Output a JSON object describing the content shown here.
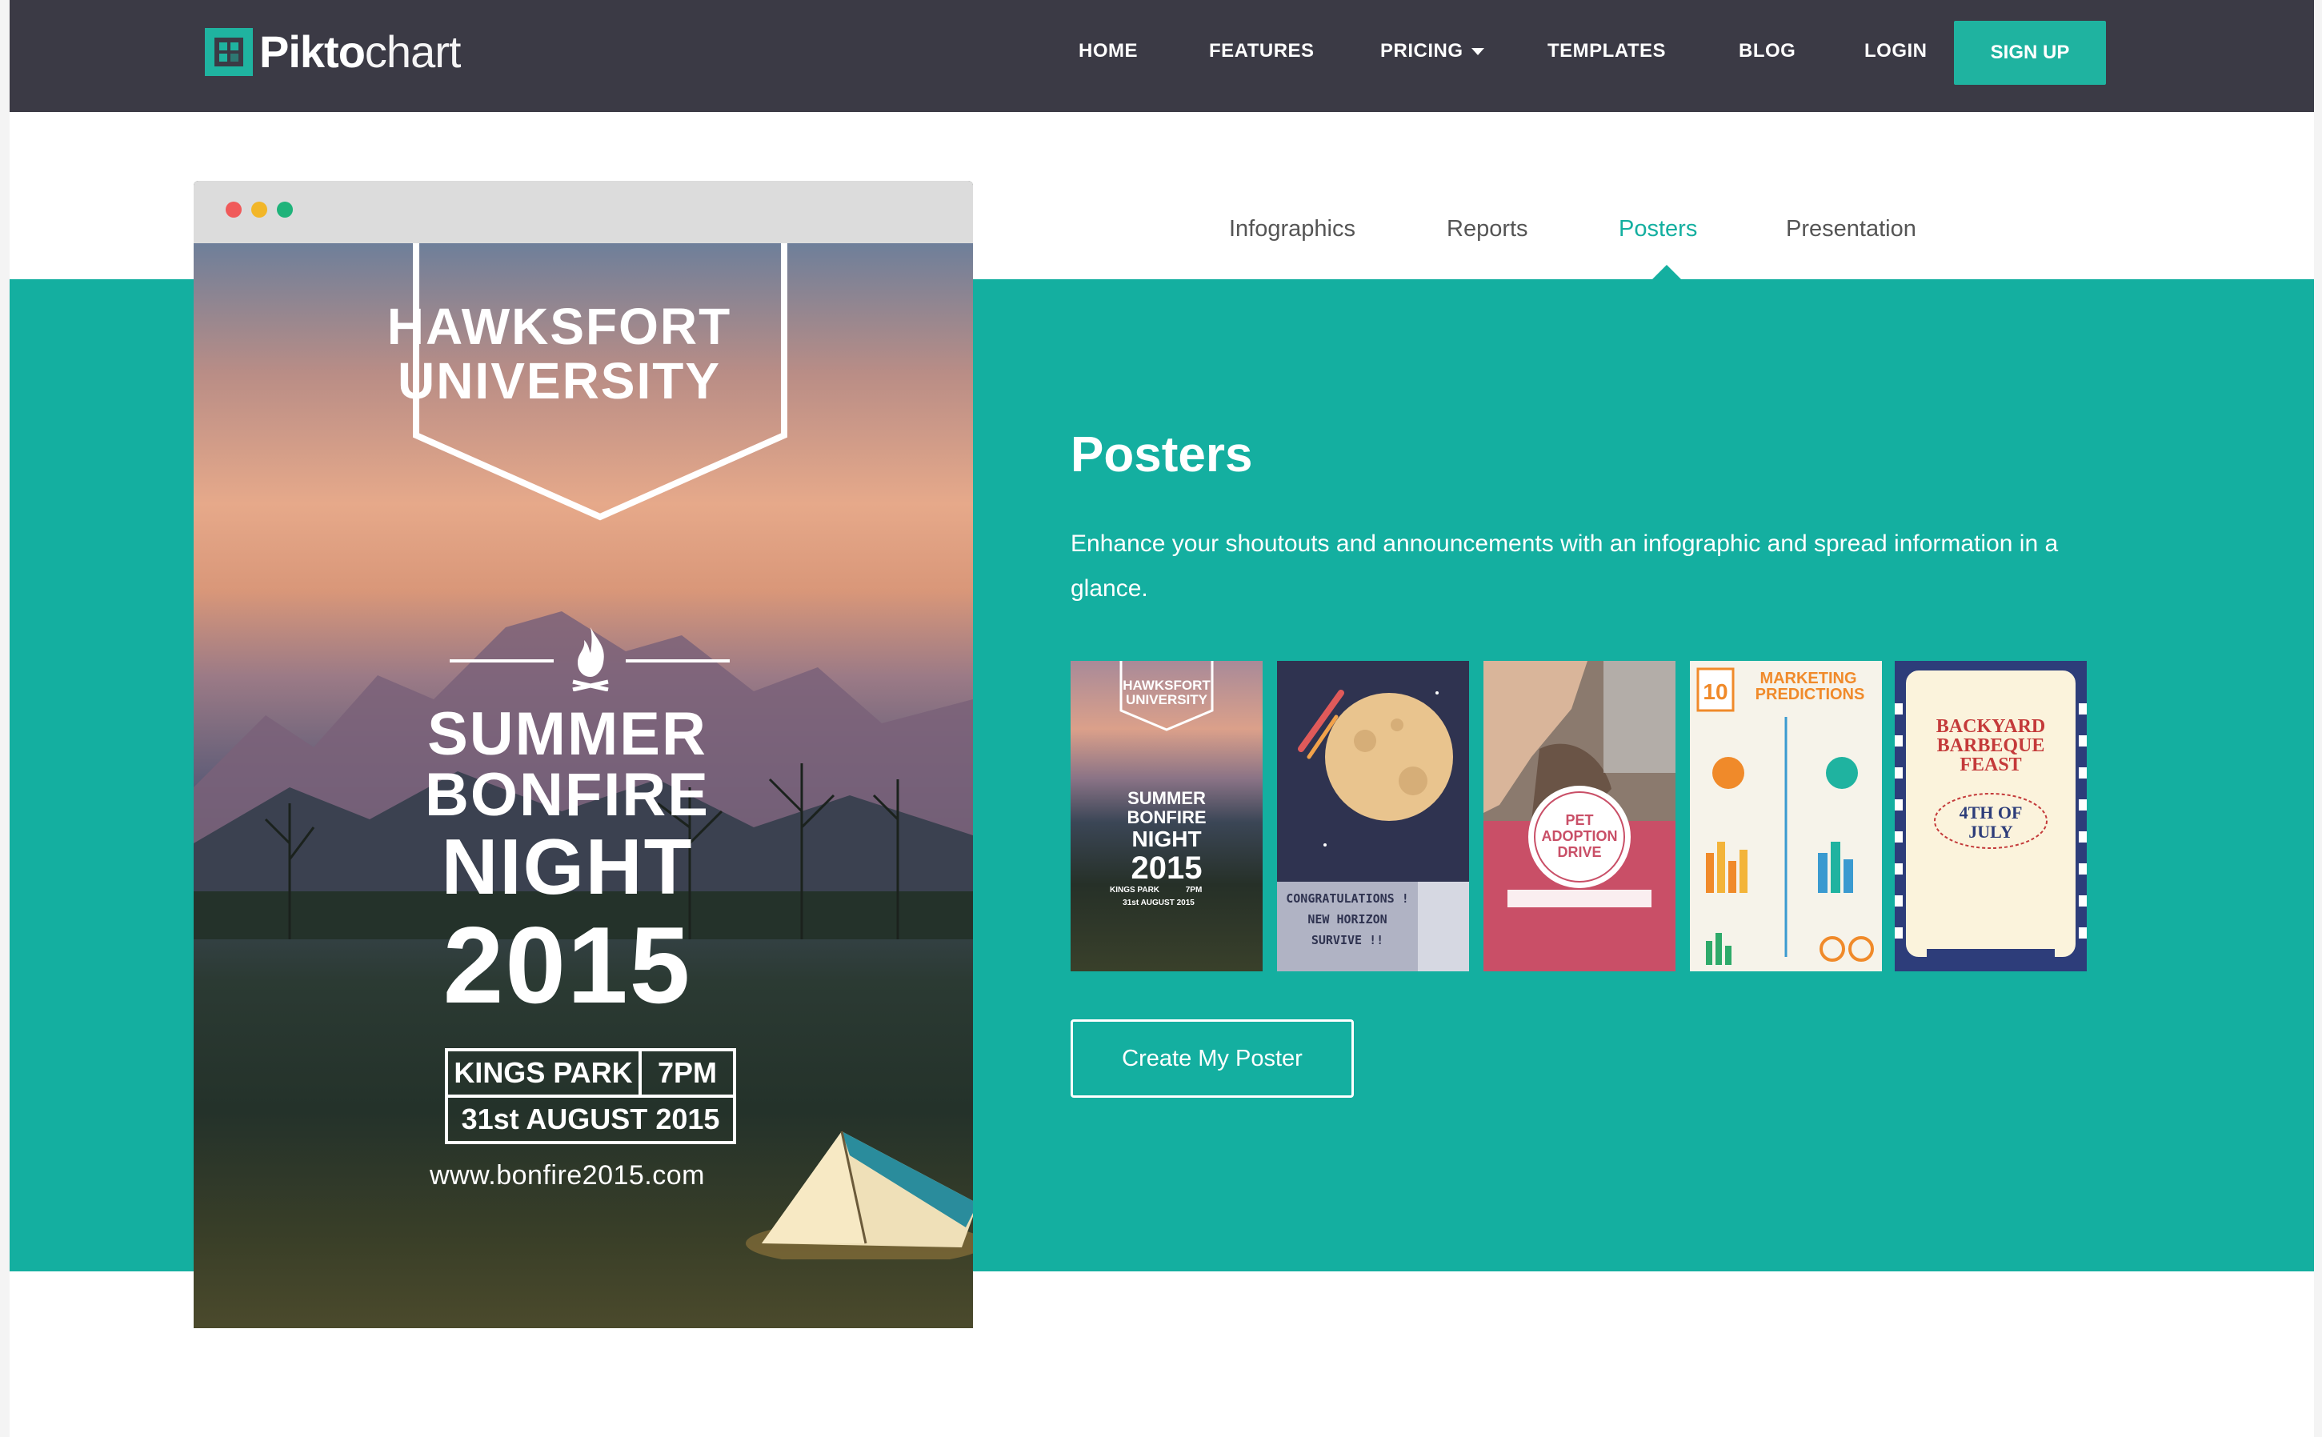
{
  "brand": {
    "logo_bold": "Pikto",
    "logo_light": "chart",
    "accent": "#14afa0",
    "nav_bg": "#3b3a45"
  },
  "nav": {
    "items": [
      "HOME",
      "FEATURES",
      "PRICING",
      "TEMPLATES",
      "BLOG",
      "LOGIN"
    ],
    "signup": "SIGN UP"
  },
  "tabs": {
    "items": [
      "Infographics",
      "Reports",
      "Posters",
      "Presentation"
    ],
    "active": "Posters"
  },
  "section": {
    "title": "Posters",
    "description": "Enhance your shoutouts and announcements with an infographic and spread information in a glance.",
    "cta": "Create My Poster"
  },
  "poster": {
    "university_line1": "HAWKSFORT",
    "university_line2": "UNIVERSITY",
    "line1": "SUMMER",
    "line2": "BONFIRE",
    "line3": "NIGHT",
    "year": "2015",
    "venue": "KINGS PARK",
    "time": "7PM",
    "date": "31st AUGUST 2015",
    "url": "www.bonfire2015.com"
  },
  "thumbnails": {
    "bonfire": {
      "l1": "HAWKSFORT",
      "l2": "UNIVERSITY",
      "l3": "SUMMER",
      "l4": "BONFIRE",
      "l5": "NIGHT",
      "l6": "2015",
      "l7": "KINGS PARK",
      "l8": "7PM",
      "l9": "31st AUGUST 2015"
    },
    "moon": {
      "l1": "CONGRATULATIONS !",
      "l2": "NEW HORIZON",
      "l3": "SURVIVE !!"
    },
    "pet": {
      "l1": "PET",
      "l2": "ADOPTION",
      "l3": "DRIVE"
    },
    "marketing": {
      "num": "10",
      "l1": "MARKETING",
      "l2": "PREDICTIONS"
    },
    "bbq": {
      "l1": "BACKYARD",
      "l2": "BARBEQUE",
      "l3": "FEAST",
      "l4": "4TH OF",
      "l5": "JULY"
    }
  }
}
